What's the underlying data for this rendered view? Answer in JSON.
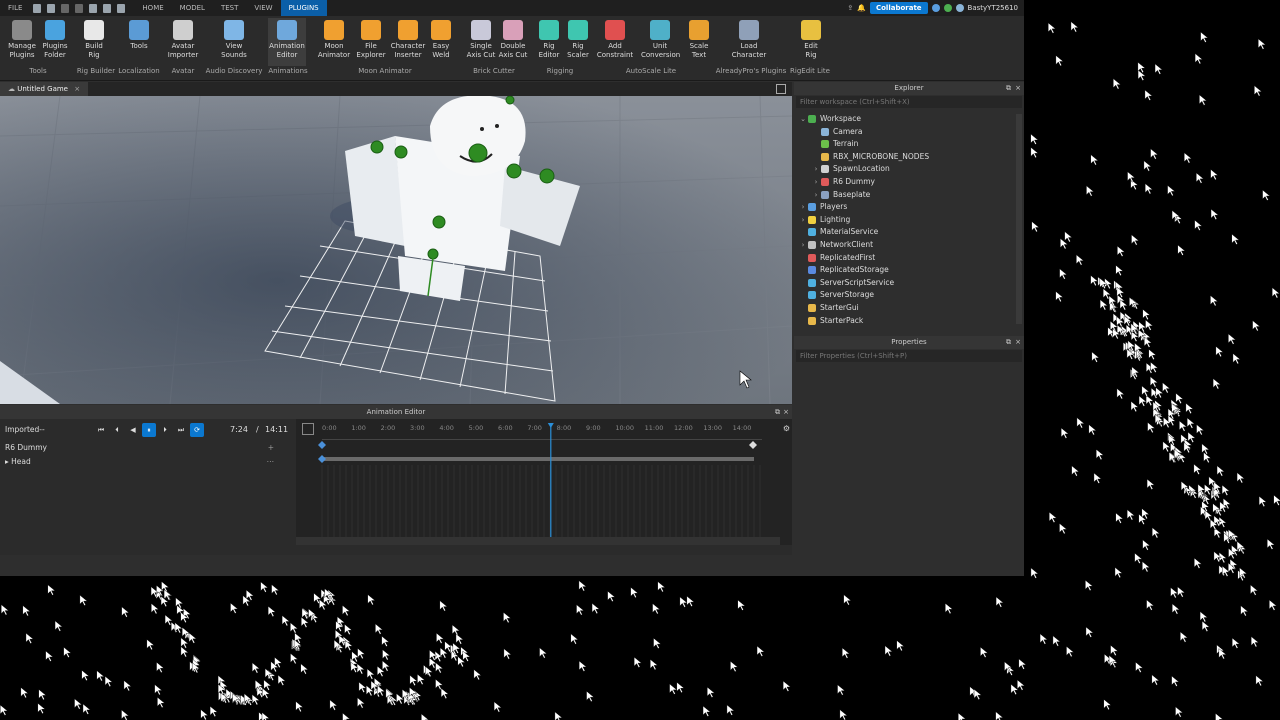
{
  "menubar": {
    "tabs": [
      "FILE",
      "HOME",
      "MODEL",
      "TEST",
      "VIEW",
      "PLUGINS"
    ],
    "active_tab": "PLUGINS",
    "collaborate_label": "Collaborate",
    "username": "BastyYT25610"
  },
  "ribbon": {
    "buttons": [
      {
        "label": "Manage\nPlugins",
        "color": "#8a8a8a"
      },
      {
        "label": "Plugins\nFolder",
        "color": "#4aa3df"
      },
      {
        "label": "Build\nRig",
        "color": "#e8e8e8"
      },
      {
        "label": "Tools",
        "color": "#5b9bd5"
      },
      {
        "label": "Avatar\nImporter",
        "color": "#cfcfcf"
      },
      {
        "label": "View\nSounds",
        "color": "#7fb6e6"
      },
      {
        "label": "Animation\nEditor",
        "color": "#6fa8dc"
      },
      {
        "label": "Moon\nAnimator",
        "color": "#f0a030"
      },
      {
        "label": "File\nExplorer",
        "color": "#f0a030"
      },
      {
        "label": "Character\nInserter",
        "color": "#f0a030"
      },
      {
        "label": "Easy\nWeld",
        "color": "#f0a030"
      },
      {
        "label": "Single\nAxis Cut",
        "color": "#c9c9d9"
      },
      {
        "label": "Double\nAxis Cut",
        "color": "#d9a0b9"
      },
      {
        "label": "Rig\nEditor",
        "color": "#3fc6b0"
      },
      {
        "label": "Rig\nScaler",
        "color": "#3fc6b0"
      },
      {
        "label": "Add\nConstraint",
        "color": "#e05050"
      },
      {
        "label": "Unit\nConversion",
        "color": "#4fb0c8"
      },
      {
        "label": "Scale\nText",
        "color": "#e8a030"
      },
      {
        "label": "Load\nCharacter",
        "color": "#8fa0b8"
      },
      {
        "label": "Edit\nRig",
        "color": "#e8c040"
      }
    ],
    "groups": [
      "Tools",
      "Rig Builder",
      "Localization",
      "Avatar",
      "Audio Discovery",
      "Animations",
      "Moon Animator",
      "Brick Cutter",
      "Rigging",
      "AutoScale Lite",
      "AlreadyPro's Plugins",
      "RigEdit Lite"
    ]
  },
  "viewport": {
    "tab_label": "Untitled Game"
  },
  "explorer": {
    "title": "Explorer",
    "filter_placeholder": "Filter workspace (Ctrl+Shift+X)",
    "items": [
      {
        "label": "Workspace",
        "level": 0,
        "arrow": "v",
        "color": "#4caf50"
      },
      {
        "label": "Camera",
        "level": 1,
        "arrow": "",
        "color": "#8ab4d8"
      },
      {
        "label": "Terrain",
        "level": 1,
        "arrow": "",
        "color": "#6cc04a"
      },
      {
        "label": "RBX_MICROBONE_NODES",
        "level": 1,
        "arrow": "",
        "color": "#e8b84a"
      },
      {
        "label": "SpawnLocation",
        "level": 1,
        "arrow": ">",
        "color": "#d0d0d0"
      },
      {
        "label": "R6 Dummy",
        "level": 1,
        "arrow": ">",
        "color": "#e05a5a"
      },
      {
        "label": "Baseplate",
        "level": 1,
        "arrow": ">",
        "color": "#8aa0c0"
      },
      {
        "label": "Players",
        "level": 0,
        "arrow": ">",
        "color": "#5a9ee0"
      },
      {
        "label": "Lighting",
        "level": 0,
        "arrow": ">",
        "color": "#f0d040"
      },
      {
        "label": "MaterialService",
        "level": 0,
        "arrow": "",
        "color": "#4fb0e0"
      },
      {
        "label": "NetworkClient",
        "level": 0,
        "arrow": ">",
        "color": "#c0c0c0"
      },
      {
        "label": "ReplicatedFirst",
        "level": 0,
        "arrow": "",
        "color": "#e05a5a"
      },
      {
        "label": "ReplicatedStorage",
        "level": 0,
        "arrow": "",
        "color": "#5a8ae0"
      },
      {
        "label": "ServerScriptService",
        "level": 0,
        "arrow": "",
        "color": "#4fb0e0"
      },
      {
        "label": "ServerStorage",
        "level": 0,
        "arrow": "",
        "color": "#4fb0e0"
      },
      {
        "label": "StarterGui",
        "level": 0,
        "arrow": "",
        "color": "#e8b84a"
      },
      {
        "label": "StarterPack",
        "level": 0,
        "arrow": "",
        "color": "#e8b84a"
      }
    ]
  },
  "properties": {
    "title": "Properties",
    "filter_placeholder": "Filter Properties (Ctrl+Shift+P)"
  },
  "animation_editor": {
    "title": "Animation Editor",
    "animation_name": "Imported--",
    "current_time": "7:24",
    "separator": "/",
    "end_time": "14:11",
    "rig_name": "R6 Dummy",
    "tracks": [
      "Head"
    ],
    "timeline_ticks": [
      "0:00",
      "1:00",
      "2:00",
      "3:00",
      "4:00",
      "5:00",
      "6:00",
      "7:00",
      "8:00",
      "9:00",
      "10:00",
      "11:00",
      "12:00",
      "13:00",
      "14:00"
    ],
    "playhead_fraction": 0.52
  }
}
